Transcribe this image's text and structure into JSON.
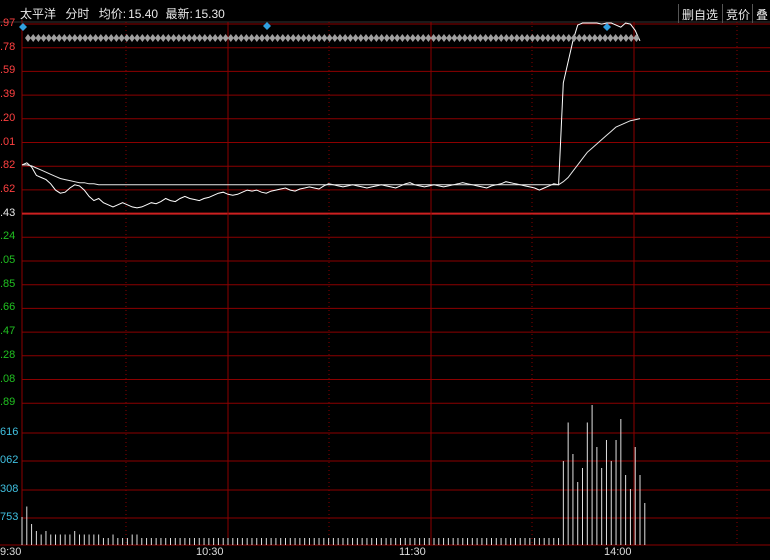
{
  "header": {
    "stock_name": "太平洋",
    "mode": "分时",
    "avg_label": "均价:",
    "avg_value": "15.40",
    "latest_label": "最新:",
    "latest_value": "15.30"
  },
  "toolbar": {
    "delete_watch": "删自选",
    "auction": "竞价",
    "overlay": "叠"
  },
  "price_labels": [
    ".97",
    ".78",
    ".59",
    ".39",
    ".20",
    ".01",
    ".82",
    ".62",
    ".43",
    ".24",
    ".05",
    ".85",
    ".66",
    ".47",
    ".28",
    ".08",
    ".89"
  ],
  "volume_labels": [
    "616",
    "062",
    "308",
    "753"
  ],
  "time_labels": [
    "9:30",
    "10:30",
    "11:30",
    "14:00"
  ],
  "colors": {
    "up": "#ff4040",
    "down": "#20c020",
    "grid": "#8b0000",
    "price_line": "#ffffff",
    "avg_line": "#e8e8e8",
    "volume_label": "#40c0e0",
    "signal_diamond": "#30a0e0",
    "marker_diamond": "#a0a0a0"
  },
  "chart_data": {
    "type": "line",
    "price_axis_decimals_shown": [
      ".97",
      ".78",
      ".59",
      ".39",
      ".20",
      ".01",
      ".82",
      ".62",
      ".43",
      ".24",
      ".05",
      ".85",
      ".66",
      ".47",
      ".28",
      ".08",
      ".89"
    ],
    "reference_label": ".43",
    "series": [
      {
        "name": "",
        "values": [
          0.62,
          0.64,
          0.6,
          0.52,
          0.5,
          0.48,
          0.44,
          0.38,
          0.35,
          0.36,
          0.4,
          0.43,
          0.42,
          0.38,
          0.32,
          0.28,
          0.3,
          0.26,
          0.24,
          0.22,
          0.24,
          0.26,
          0.24,
          0.22,
          0.21,
          0.22,
          0.24,
          0.26,
          0.25,
          0.27,
          0.3,
          0.28,
          0.27,
          0.3,
          0.32,
          0.3,
          0.29,
          0.28,
          0.3,
          0.31,
          0.33,
          0.35,
          0.36,
          0.34,
          0.33,
          0.34,
          0.36,
          0.38,
          0.37,
          0.38,
          0.36,
          0.35,
          0.37,
          0.38,
          0.39,
          0.4,
          0.38,
          0.37,
          0.39,
          0.4,
          0.41,
          0.4,
          0.39,
          0.42,
          0.44,
          0.43,
          0.42,
          0.41,
          0.42,
          0.43,
          0.42,
          0.41,
          0.4,
          0.41,
          0.42,
          0.43,
          0.42,
          0.41,
          0.4,
          0.42,
          0.44,
          0.45,
          0.43,
          0.42,
          0.41,
          0.42,
          0.43,
          0.42,
          0.41,
          0.42,
          0.43,
          0.44,
          0.45,
          0.44,
          0.43,
          0.42,
          0.41,
          0.4,
          0.42,
          0.43,
          0.44,
          0.46,
          0.45,
          0.44,
          0.43,
          0.42,
          0.41,
          0.4,
          0.38,
          0.4,
          0.42,
          0.44,
          0.43,
          1.4,
          1.6,
          1.8,
          1.95,
          1.97,
          1.97,
          1.97,
          1.97,
          1.96,
          1.97,
          1.97,
          1.95,
          1.93,
          1.97,
          1.96,
          1.9,
          1.8
        ]
      },
      {
        "name": "",
        "values": [
          0.62,
          0.62,
          0.61,
          0.59,
          0.57,
          0.55,
          0.53,
          0.51,
          0.49,
          0.48,
          0.47,
          0.46,
          0.45,
          0.45,
          0.44,
          0.44,
          0.43,
          0.43,
          0.43,
          0.43,
          0.43,
          0.43,
          0.43,
          0.43,
          0.43,
          0.43,
          0.43,
          0.43,
          0.43,
          0.43,
          0.43,
          0.43,
          0.43,
          0.43,
          0.43,
          0.43,
          0.43,
          0.43,
          0.43,
          0.43,
          0.43,
          0.43,
          0.43,
          0.43,
          0.43,
          0.43,
          0.43,
          0.43,
          0.43,
          0.43,
          0.43,
          0.43,
          0.43,
          0.43,
          0.43,
          0.43,
          0.43,
          0.43,
          0.43,
          0.43,
          0.43,
          0.43,
          0.43,
          0.43,
          0.43,
          0.43,
          0.43,
          0.43,
          0.43,
          0.43,
          0.43,
          0.43,
          0.43,
          0.43,
          0.43,
          0.43,
          0.43,
          0.43,
          0.43,
          0.43,
          0.43,
          0.43,
          0.43,
          0.43,
          0.43,
          0.43,
          0.43,
          0.43,
          0.43,
          0.43,
          0.43,
          0.43,
          0.43,
          0.43,
          0.43,
          0.43,
          0.43,
          0.43,
          0.43,
          0.43,
          0.43,
          0.43,
          0.43,
          0.43,
          0.43,
          0.43,
          0.43,
          0.43,
          0.43,
          0.43,
          0.43,
          0.43,
          0.43,
          0.46,
          0.5,
          0.56,
          0.62,
          0.68,
          0.74,
          0.78,
          0.82,
          0.86,
          0.9,
          0.94,
          0.98,
          1.0,
          1.02,
          1.04,
          1.05,
          1.06
        ]
      }
    ],
    "volume": [
      8,
      11,
      6,
      4,
      3,
      4,
      3,
      3,
      3,
      3,
      3,
      4,
      3,
      3,
      3,
      3,
      3,
      2,
      2,
      3,
      2,
      2,
      2,
      3,
      3,
      2,
      2,
      2,
      2,
      2,
      2,
      2,
      2,
      2,
      2,
      2,
      2,
      2,
      2,
      2,
      2,
      2,
      2,
      2,
      2,
      2,
      2,
      2,
      2,
      2,
      2,
      2,
      2,
      2,
      2,
      2,
      2,
      2,
      2,
      2,
      2,
      2,
      2,
      2,
      2,
      2,
      2,
      2,
      2,
      2,
      2,
      2,
      2,
      2,
      2,
      2,
      2,
      2,
      2,
      2,
      2,
      2,
      2,
      2,
      2,
      2,
      2,
      2,
      2,
      2,
      2,
      2,
      2,
      2,
      2,
      2,
      2,
      2,
      2,
      2,
      2,
      2,
      2,
      2,
      2,
      2,
      2,
      2,
      2,
      2,
      2,
      2,
      2,
      24,
      35,
      26,
      18,
      22,
      35,
      40,
      28,
      22,
      30,
      24,
      30,
      36,
      20,
      16,
      28,
      20,
      12
    ]
  }
}
